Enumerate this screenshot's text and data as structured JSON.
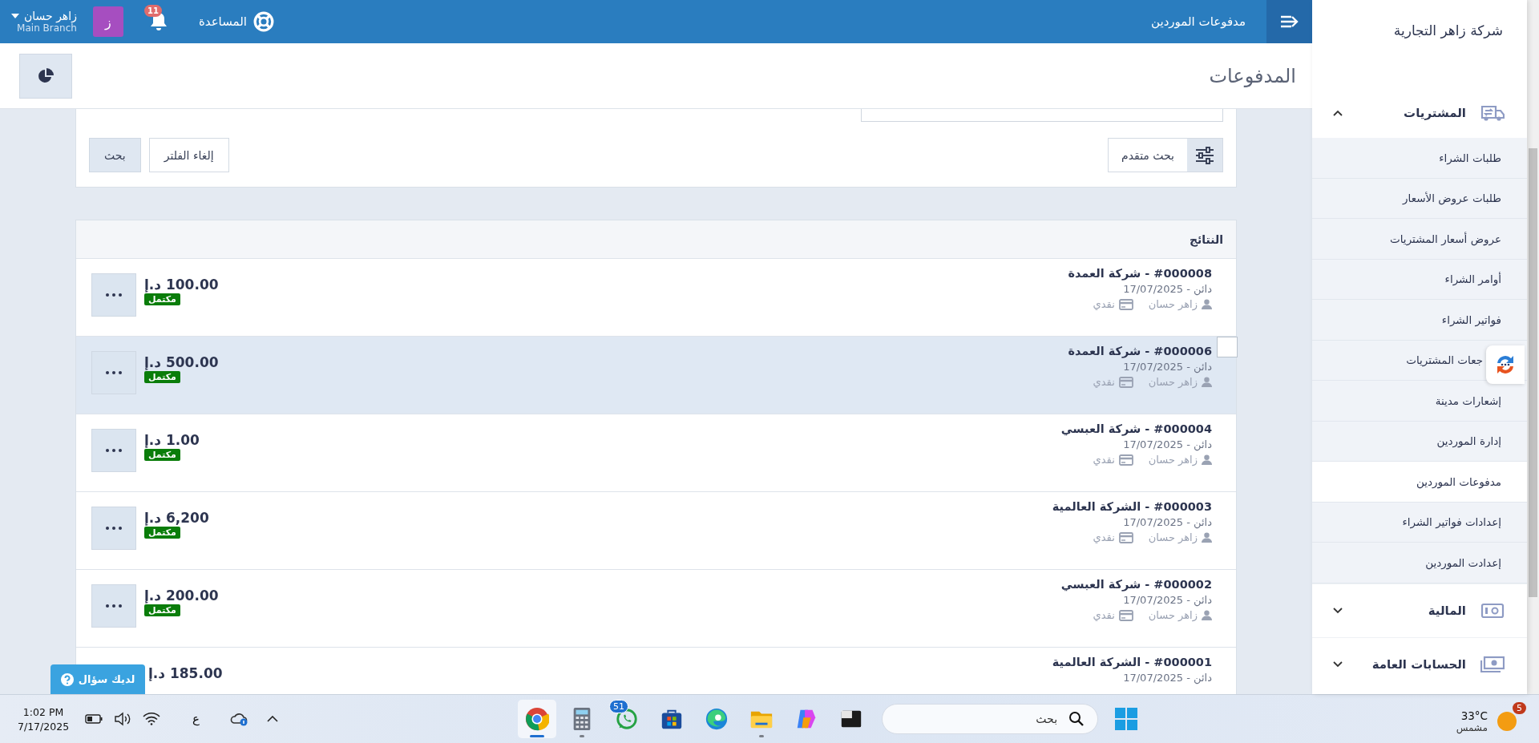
{
  "topbar": {
    "page_title": "مدفوعات الموردين",
    "help": "المساعدة",
    "notifications": "11",
    "avatar": "ز",
    "user": "زاهر حسان",
    "branch": "Main Branch"
  },
  "header": {
    "title": "المدفوعات"
  },
  "filter": {
    "advanced": "بحث متقدم",
    "clear": "إلغاء الفلتر",
    "search": "بحث"
  },
  "results": {
    "title": "النتائج",
    "rows": [
      {
        "title": "#000008 - شركة العمدة",
        "date": "دائن - 17/07/2025",
        "user": "زاهر حسان",
        "method": "نقدي",
        "amount": "100.00 د.إ",
        "status": "مكتمل",
        "selected": false
      },
      {
        "title": "#000006 - شركة العمدة",
        "date": "دائن - 17/07/2025",
        "user": "زاهر حسان",
        "method": "نقدي",
        "amount": "500.00 د.إ",
        "status": "مكتمل",
        "selected": true
      },
      {
        "title": "#000004 - شركة العبسي",
        "date": "دائن - 17/07/2025",
        "user": "زاهر حسان",
        "method": "نقدي",
        "amount": "1.00 د.إ",
        "status": "مكتمل",
        "selected": false
      },
      {
        "title": "#000003 - الشركة العالمية",
        "date": "دائن - 17/07/2025",
        "user": "زاهر حسان",
        "method": "نقدي",
        "amount": "6,200 د.إ",
        "status": "مكتمل",
        "selected": false
      },
      {
        "title": "#000002 - شركة العبسي",
        "date": "دائن - 17/07/2025",
        "user": "زاهر حسان",
        "method": "نقدي",
        "amount": "200.00 د.إ",
        "status": "مكتمل",
        "selected": false
      },
      {
        "title": "#000001 - الشركة العالمية",
        "date": "دائن - 17/07/2025",
        "amount": "185.00 د.إ",
        "selected": false
      }
    ]
  },
  "help_button": "لديك سؤال",
  "sidebar": {
    "company": "شركة زاهر التجارية",
    "sections": [
      {
        "label": "المشتريات",
        "expanded": true,
        "items": [
          {
            "label": "طلبات الشراء",
            "selected": false
          },
          {
            "label": "طلبات عروض الأسعار",
            "selected": false
          },
          {
            "label": "عروض أسعار المشتريات",
            "selected": false
          },
          {
            "label": "أوامر الشراء",
            "selected": false
          },
          {
            "label": "فواتير الشراء",
            "selected": false
          },
          {
            "label": "جعات المشتريات",
            "selected": false,
            "covered": true
          },
          {
            "label": "إشعارات مدينة",
            "selected": false
          },
          {
            "label": "إدارة الموردين",
            "selected": false
          },
          {
            "label": "مدفوعات الموردين",
            "selected": true
          },
          {
            "label": "إعدادات فواتير الشراء",
            "selected": false
          },
          {
            "label": "إعدادت الموردين",
            "selected": false
          }
        ]
      },
      {
        "label": "المالية",
        "expanded": false
      },
      {
        "label": "الحسابات العامة",
        "expanded": false
      }
    ]
  },
  "taskbar": {
    "time": "1:02 PM",
    "date": "7/17/2025",
    "language": "ع",
    "search_placeholder": "بحث",
    "weather_temp": "33°C",
    "weather_text": "مشمس",
    "weather_badge": "5",
    "apps": [
      {
        "kind": "chrome",
        "selected": true,
        "running": true
      },
      {
        "kind": "calculator",
        "selected": false,
        "running": true
      },
      {
        "kind": "whatsapp",
        "selected": false,
        "running": false,
        "badge": "51"
      },
      {
        "kind": "store",
        "selected": false,
        "running": false
      },
      {
        "kind": "edge",
        "selected": false,
        "running": false
      },
      {
        "kind": "explorer",
        "selected": false,
        "running": true
      },
      {
        "kind": "copilot",
        "selected": false,
        "running": false
      },
      {
        "kind": "terminal",
        "selected": false,
        "running": false
      }
    ]
  }
}
